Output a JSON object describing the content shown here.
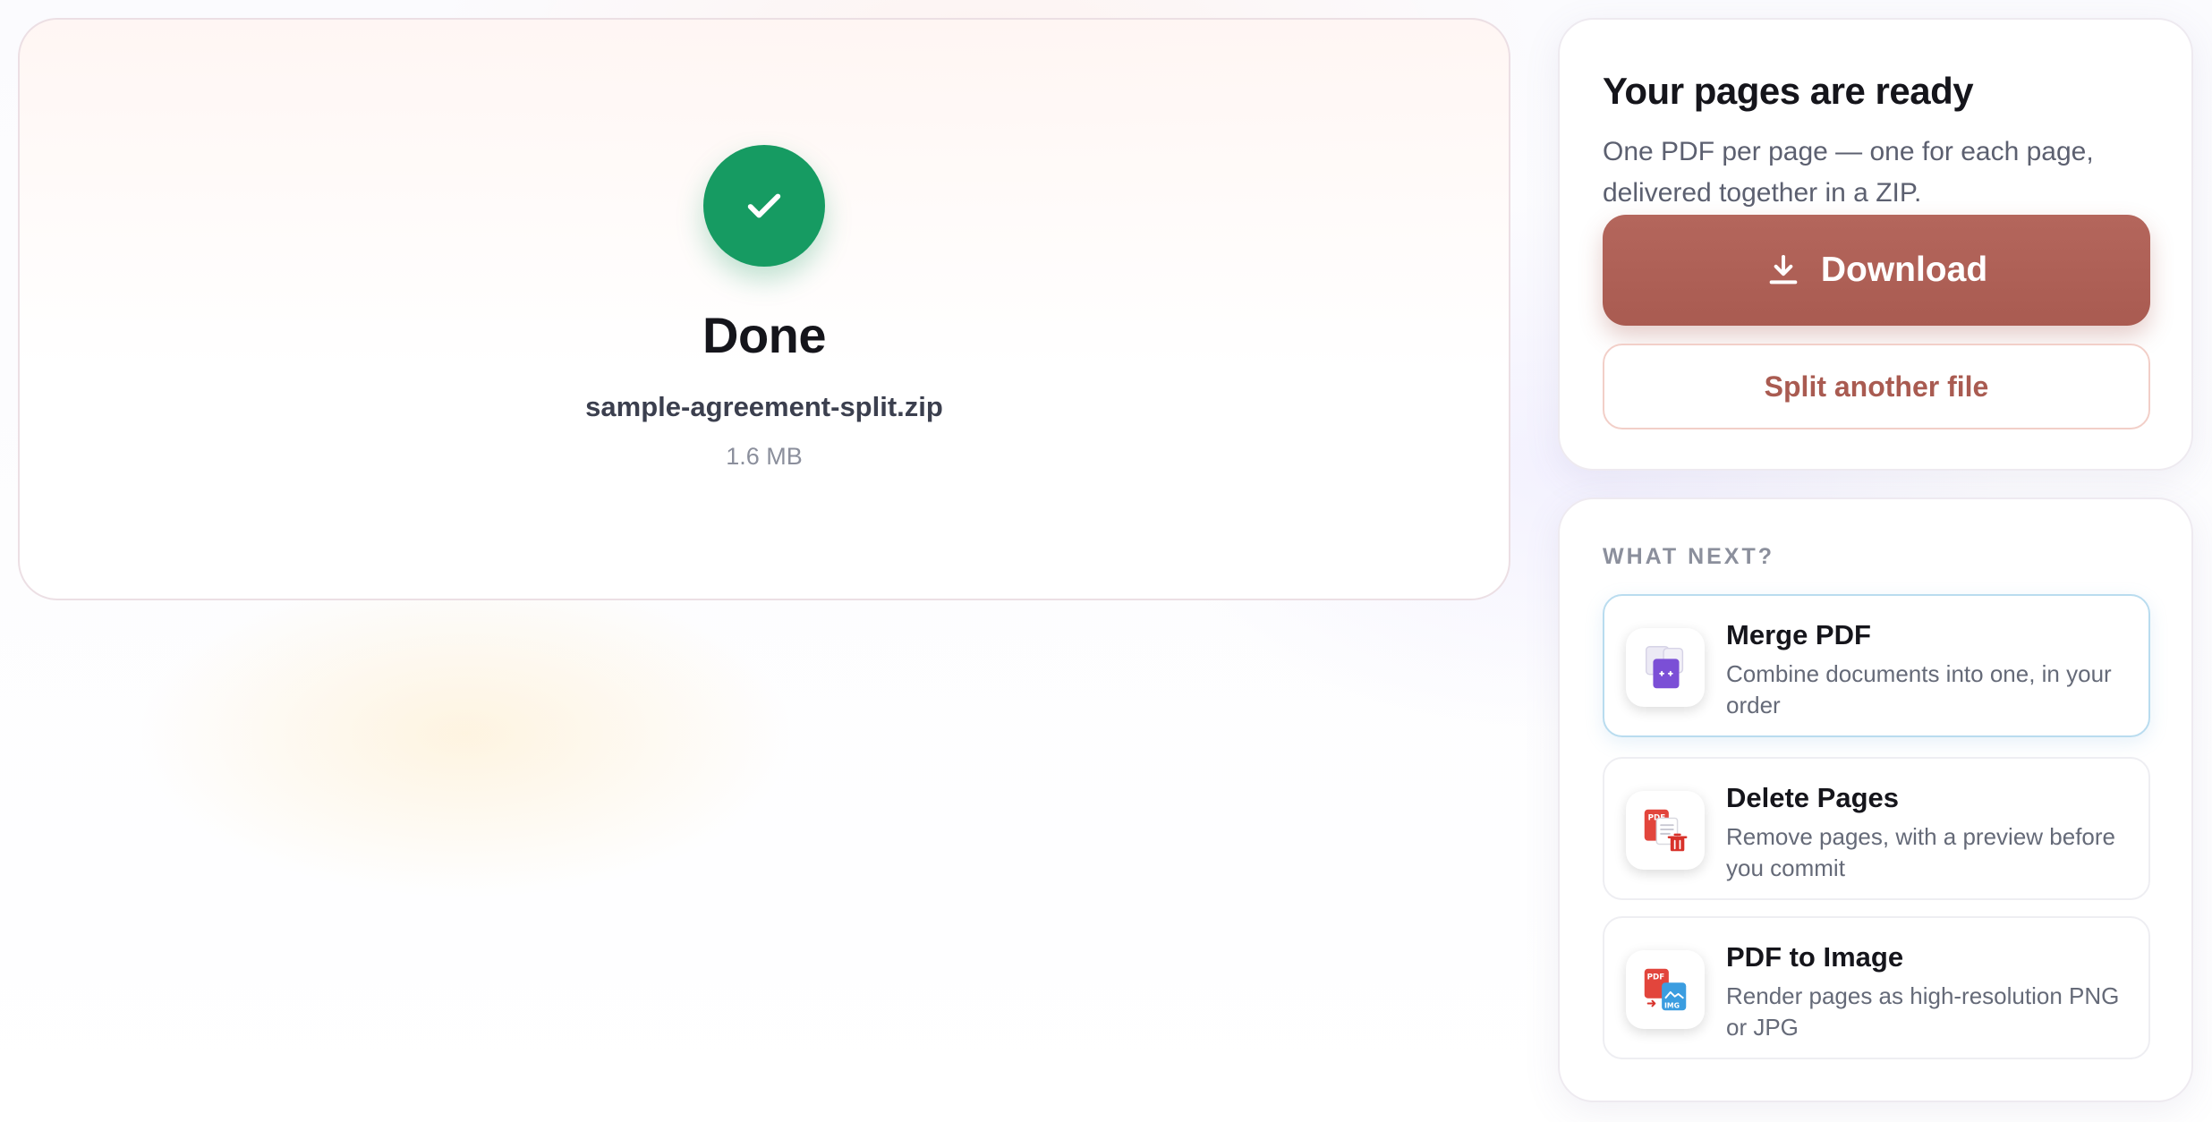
{
  "status": {
    "title": "Done",
    "file_name": "sample-agreement-split.zip",
    "file_size": "1.6 MB",
    "icon": "check-icon",
    "color": "#169b62"
  },
  "ready": {
    "title": "Your pages are ready",
    "description": "One PDF per page — one for each page, delivered together in a ZIP.",
    "download_label": "Download",
    "download_icon": "download-icon",
    "split_label": "Split another file",
    "accent": "#a95b51"
  },
  "next": {
    "heading": "WHAT NEXT?",
    "tools": [
      {
        "title": "Merge PDF",
        "description": "Combine documents into one, in your order",
        "icon": "merge-pdf-icon"
      },
      {
        "title": "Delete Pages",
        "description": "Remove pages, with a preview before you commit",
        "icon": "delete-pages-icon"
      },
      {
        "title": "PDF to Image",
        "description": "Render pages as high-resolution PNG or JPG",
        "icon": "pdf-to-image-icon"
      }
    ]
  }
}
